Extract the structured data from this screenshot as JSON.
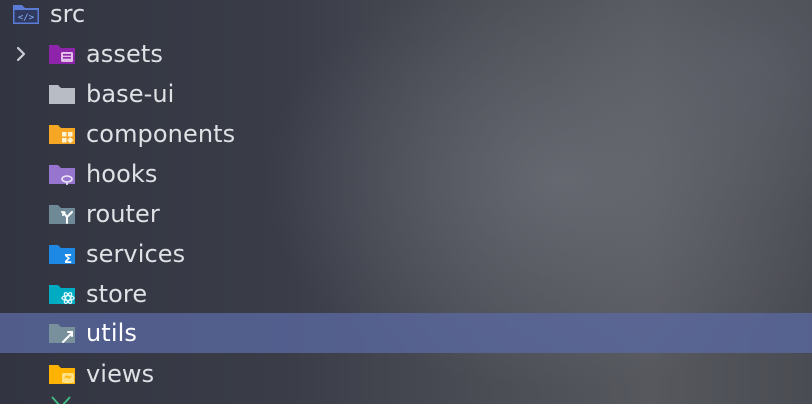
{
  "tree": {
    "root": {
      "label": "src",
      "icon": "src-folder-icon"
    },
    "items": [
      {
        "label": "assets",
        "icon": "assets-folder-icon",
        "expandable": true
      },
      {
        "label": "base-ui",
        "icon": "plain-folder-icon"
      },
      {
        "label": "components",
        "icon": "components-folder-icon"
      },
      {
        "label": "hooks",
        "icon": "hooks-folder-icon"
      },
      {
        "label": "router",
        "icon": "router-folder-icon"
      },
      {
        "label": "services",
        "icon": "services-folder-icon"
      },
      {
        "label": "store",
        "icon": "store-folder-icon"
      },
      {
        "label": "utils",
        "icon": "utils-folder-icon",
        "selected": true
      },
      {
        "label": "views",
        "icon": "views-folder-icon"
      }
    ]
  },
  "colors": {
    "selection": "#5a68a0",
    "text": "#dfe1e5",
    "src_folder": "#5b7bd5",
    "assets_folder": "#8e24aa",
    "plain_folder": "#b8bcc4",
    "components_folder": "#f5a623",
    "hooks_folder": "#9575cd",
    "router_folder": "#6f8a96",
    "services_folder": "#1e88e5",
    "store_folder": "#00acc1",
    "utils_folder": "#78909c",
    "views_folder": "#ffb300"
  }
}
